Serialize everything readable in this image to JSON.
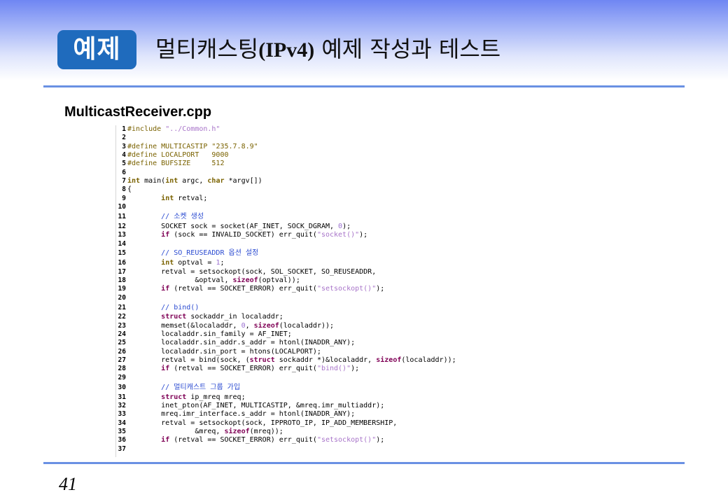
{
  "header": {
    "badge": "예제",
    "title_prefix": "멀티캐스팅",
    "title_tech": "(IPv4)",
    "title_suffix": " 예제 작성과 테스트"
  },
  "file_name": "MulticastReceiver.cpp",
  "code_lines": [
    {
      "n": "1",
      "segs": [
        {
          "t": "#include ",
          "c": "pp"
        },
        {
          "t": "\"../Common.h\"",
          "c": "str"
        }
      ]
    },
    {
      "n": "2",
      "segs": []
    },
    {
      "n": "3",
      "segs": [
        {
          "t": "#define MULTICASTIP ",
          "c": "pp"
        },
        {
          "t": "\"235.7.8.9\"",
          "c": "pp"
        }
      ]
    },
    {
      "n": "4",
      "segs": [
        {
          "t": "#define LOCALPORT   9000",
          "c": "pp"
        }
      ]
    },
    {
      "n": "5",
      "segs": [
        {
          "t": "#define BUFSIZE     512",
          "c": "pp"
        }
      ]
    },
    {
      "n": "6",
      "segs": []
    },
    {
      "n": "7",
      "segs": [
        {
          "t": "int",
          "c": "ty"
        },
        {
          "t": " main(",
          "c": ""
        },
        {
          "t": "int",
          "c": "ty"
        },
        {
          "t": " argc, ",
          "c": ""
        },
        {
          "t": "char",
          "c": "ty"
        },
        {
          "t": " *argv[])",
          "c": ""
        }
      ]
    },
    {
      "n": "8",
      "segs": [
        {
          "t": "{",
          "c": ""
        }
      ]
    },
    {
      "n": "9",
      "segs": [
        {
          "t": "        ",
          "c": ""
        },
        {
          "t": "int",
          "c": "ty"
        },
        {
          "t": " retval;",
          "c": ""
        }
      ]
    },
    {
      "n": "10",
      "segs": []
    },
    {
      "n": "11",
      "segs": [
        {
          "t": "        // 소켓 생성",
          "c": "cm"
        }
      ]
    },
    {
      "n": "12",
      "segs": [
        {
          "t": "        SOCKET sock = socket(AF_INET, SOCK_DGRAM, ",
          "c": ""
        },
        {
          "t": "0",
          "c": "num"
        },
        {
          "t": ");",
          "c": ""
        }
      ]
    },
    {
      "n": "13",
      "segs": [
        {
          "t": "        ",
          "c": ""
        },
        {
          "t": "if",
          "c": "kw"
        },
        {
          "t": " (sock == INVALID_SOCKET) err_quit(",
          "c": ""
        },
        {
          "t": "\"socket()\"",
          "c": "str"
        },
        {
          "t": ");",
          "c": ""
        }
      ]
    },
    {
      "n": "14",
      "segs": []
    },
    {
      "n": "15",
      "segs": [
        {
          "t": "        // SO_REUSEADDR 옵션 설정",
          "c": "cm"
        }
      ]
    },
    {
      "n": "16",
      "segs": [
        {
          "t": "        ",
          "c": ""
        },
        {
          "t": "int",
          "c": "ty"
        },
        {
          "t": " optval = ",
          "c": ""
        },
        {
          "t": "1",
          "c": "num"
        },
        {
          "t": ";",
          "c": ""
        }
      ]
    },
    {
      "n": "17",
      "segs": [
        {
          "t": "        retval = setsockopt(sock, SOL_SOCKET, SO_REUSEADDR,",
          "c": ""
        }
      ]
    },
    {
      "n": "18",
      "segs": [
        {
          "t": "                &optval, ",
          "c": ""
        },
        {
          "t": "sizeof",
          "c": "kw"
        },
        {
          "t": "(optval));",
          "c": ""
        }
      ]
    },
    {
      "n": "19",
      "segs": [
        {
          "t": "        ",
          "c": ""
        },
        {
          "t": "if",
          "c": "kw"
        },
        {
          "t": " (retval == SOCKET_ERROR) err_quit(",
          "c": ""
        },
        {
          "t": "\"setsockopt()\"",
          "c": "str"
        },
        {
          "t": ");",
          "c": ""
        }
      ]
    },
    {
      "n": "20",
      "segs": []
    },
    {
      "n": "21",
      "segs": [
        {
          "t": "        // bind()",
          "c": "cm"
        }
      ]
    },
    {
      "n": "22",
      "segs": [
        {
          "t": "        ",
          "c": ""
        },
        {
          "t": "struct",
          "c": "kw"
        },
        {
          "t": " sockaddr_in localaddr;",
          "c": ""
        }
      ]
    },
    {
      "n": "23",
      "segs": [
        {
          "t": "        memset(&localaddr, ",
          "c": ""
        },
        {
          "t": "0",
          "c": "num"
        },
        {
          "t": ", ",
          "c": ""
        },
        {
          "t": "sizeof",
          "c": "kw"
        },
        {
          "t": "(localaddr));",
          "c": ""
        }
      ]
    },
    {
      "n": "24",
      "segs": [
        {
          "t": "        localaddr.sin_family = AF_INET;",
          "c": ""
        }
      ]
    },
    {
      "n": "25",
      "segs": [
        {
          "t": "        localaddr.sin_addr.s_addr = htonl(INADDR_ANY);",
          "c": ""
        }
      ]
    },
    {
      "n": "26",
      "segs": [
        {
          "t": "        localaddr.sin_port = htons(LOCALPORT);",
          "c": ""
        }
      ]
    },
    {
      "n": "27",
      "segs": [
        {
          "t": "        retval = bind(sock, (",
          "c": ""
        },
        {
          "t": "struct",
          "c": "kw"
        },
        {
          "t": " sockaddr *)&localaddr, ",
          "c": ""
        },
        {
          "t": "sizeof",
          "c": "kw"
        },
        {
          "t": "(localaddr));",
          "c": ""
        }
      ]
    },
    {
      "n": "28",
      "segs": [
        {
          "t": "        ",
          "c": ""
        },
        {
          "t": "if",
          "c": "kw"
        },
        {
          "t": " (retval == SOCKET_ERROR) err_quit(",
          "c": ""
        },
        {
          "t": "\"bind()\"",
          "c": "str"
        },
        {
          "t": ");",
          "c": ""
        }
      ]
    },
    {
      "n": "29",
      "segs": []
    },
    {
      "n": "30",
      "segs": [
        {
          "t": "        // 멀티캐스트 그룹 가입",
          "c": "cm"
        }
      ]
    },
    {
      "n": "31",
      "segs": [
        {
          "t": "        ",
          "c": ""
        },
        {
          "t": "struct",
          "c": "kw"
        },
        {
          "t": " ip_mreq mreq;",
          "c": ""
        }
      ]
    },
    {
      "n": "32",
      "segs": [
        {
          "t": "        inet_pton(AF_INET, MULTICASTIP, &mreq.imr_multiaddr);",
          "c": ""
        }
      ]
    },
    {
      "n": "33",
      "segs": [
        {
          "t": "        mreq.imr_interface.s_addr = htonl(INADDR_ANY);",
          "c": ""
        }
      ]
    },
    {
      "n": "34",
      "segs": [
        {
          "t": "        retval = setsockopt(sock, IPPROTO_IP, IP_ADD_MEMBERSHIP,",
          "c": ""
        }
      ]
    },
    {
      "n": "35",
      "segs": [
        {
          "t": "                &mreq, ",
          "c": ""
        },
        {
          "t": "sizeof",
          "c": "kw"
        },
        {
          "t": "(mreq));",
          "c": ""
        }
      ]
    },
    {
      "n": "36",
      "segs": [
        {
          "t": "        ",
          "c": ""
        },
        {
          "t": "if",
          "c": "kw"
        },
        {
          "t": " (retval == SOCKET_ERROR) err_quit(",
          "c": ""
        },
        {
          "t": "\"setsockopt()\"",
          "c": "str"
        },
        {
          "t": ");",
          "c": ""
        }
      ]
    },
    {
      "n": "37",
      "segs": []
    }
  ],
  "page_number": "41",
  "colors": {
    "badge_bg": "#1f6bbd",
    "rule": "#6a91e3",
    "keyword": "#7f0055",
    "type": "#7a6200",
    "string": "#a874c9",
    "comment": "#2b4bd1"
  }
}
